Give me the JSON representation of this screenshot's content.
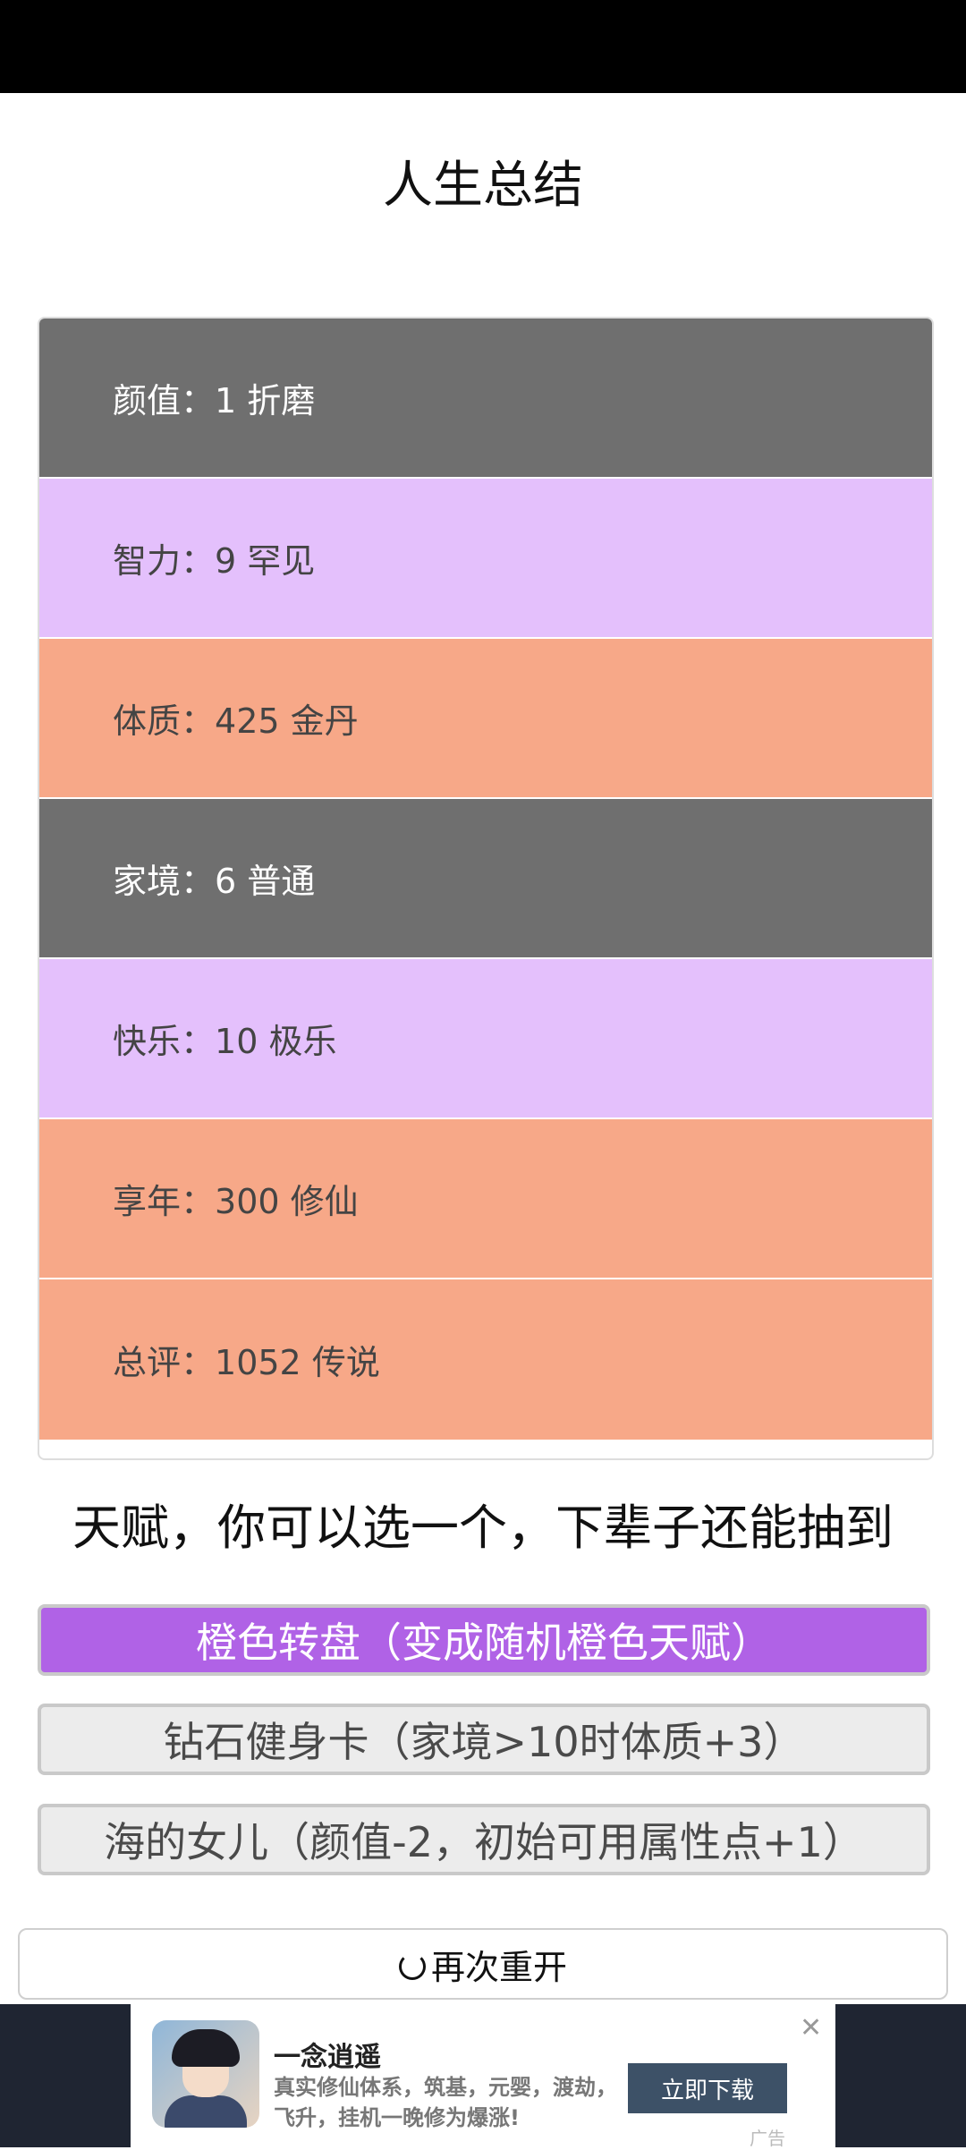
{
  "page": {
    "title": "人生总结"
  },
  "stats": [
    {
      "label": "颜值",
      "sep": "：",
      "value": "1 折磨",
      "bg": "#6f6f6f",
      "fg": "#ffffff"
    },
    {
      "label": "智力",
      "sep": "：",
      "value": "9 罕见",
      "bg": "#e4c0fc",
      "fg": "#444444"
    },
    {
      "label": "体质",
      "sep": "：",
      "value": "425 金丹",
      "bg": "#f7a888",
      "fg": "#444444"
    },
    {
      "label": "家境",
      "sep": "：",
      "value": "6 普通",
      "bg": "#6f6f6f",
      "fg": "#ffffff"
    },
    {
      "label": "快乐",
      "sep": "：",
      "value": "10 极乐",
      "bg": "#e4c0fc",
      "fg": "#444444"
    },
    {
      "label": "享年",
      "sep": "：",
      "value": "300 修仙",
      "bg": "#f7a888",
      "fg": "#444444"
    },
    {
      "label": "总评",
      "sep": "：",
      "value": "1052 传说",
      "bg": "#f7a888",
      "fg": "#444444"
    }
  ],
  "talents": {
    "heading": "天赋，你可以选一个，下辈子还能抽到",
    "options": [
      {
        "label": "橙色转盘（变成随机橙色天赋）",
        "selected": true,
        "bg": "#b062e6"
      },
      {
        "label": "钻石健身卡（家境>10时体质+3）",
        "selected": false,
        "bg": "#ececec"
      },
      {
        "label": "海的女儿（颜值-2，初始可用属性点+1）",
        "selected": false,
        "bg": "#ececec"
      }
    ]
  },
  "restart": {
    "label": "再次重开",
    "icon": "restart-icon"
  },
  "ad": {
    "title": "一念逍遥",
    "description": "真实修仙体系，筑基，元婴，渡劫，飞升，挂机一晚修为爆涨!",
    "download_label": "立即下载",
    "close_glyph": "✕",
    "ad_tag": "广告"
  }
}
